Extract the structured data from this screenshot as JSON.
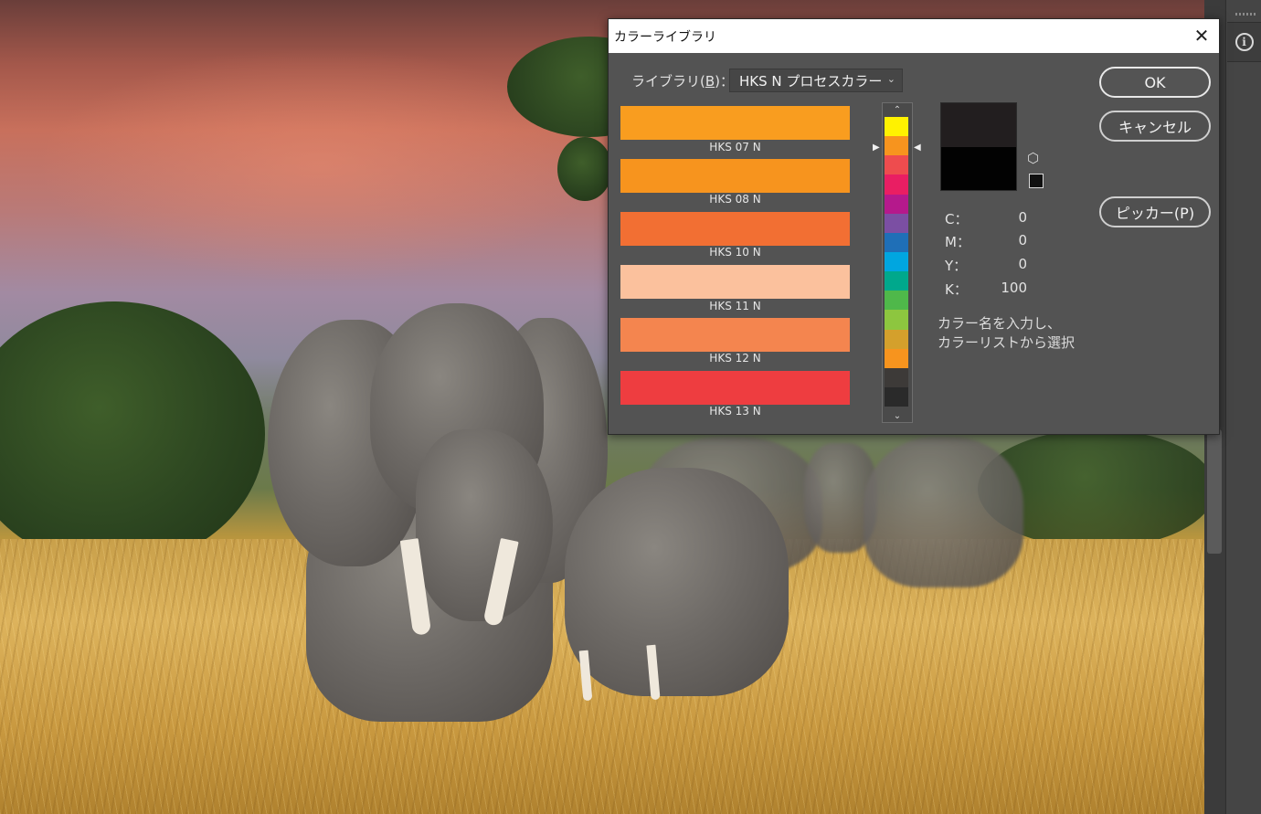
{
  "dialog": {
    "title": "カラーライブラリ",
    "close_glyph": "✕",
    "library_label_prefix": "ライブラリ(",
    "library_label_key": "B",
    "library_label_suffix": ")：",
    "library_value": "HKS N プロセスカラー",
    "swatches": [
      {
        "name": "HKS 07 N",
        "color": "#f99d1f"
      },
      {
        "name": "HKS 08 N",
        "color": "#f7941e"
      },
      {
        "name": "HKS 10 N",
        "color": "#f26f33"
      },
      {
        "name": "HKS 11 N",
        "color": "#fbc19d"
      },
      {
        "name": "HKS 12 N",
        "color": "#f4854f"
      },
      {
        "name": "HKS 13 N",
        "color": "#ee3d40"
      }
    ],
    "spectrum_colors": [
      "#fff200",
      "#f7941e",
      "#ee4c4e",
      "#e91e63",
      "#b5198c",
      "#7b4fa3",
      "#1f6fb7",
      "#00a6e0",
      "#00a88c",
      "#4fb84a",
      "#8dc63f",
      "#d4a02c",
      "#f7941e",
      "#3d3a38",
      "#2a2a2a"
    ],
    "preview": {
      "new_color": "#221e1f",
      "current_color": "#020202"
    },
    "cmyk": [
      {
        "key": "C：",
        "value": "0"
      },
      {
        "key": "M：",
        "value": "0"
      },
      {
        "key": "Y：",
        "value": "0"
      },
      {
        "key": "K：",
        "value": "100"
      }
    ],
    "hint_line1": "カラー名を入力し、",
    "hint_line2": "カラーリストから選択",
    "buttons": {
      "ok": "OK",
      "cancel": "キャンセル",
      "picker": "ピッカー(P)"
    }
  },
  "side_panel": {
    "info_icon": "i"
  }
}
